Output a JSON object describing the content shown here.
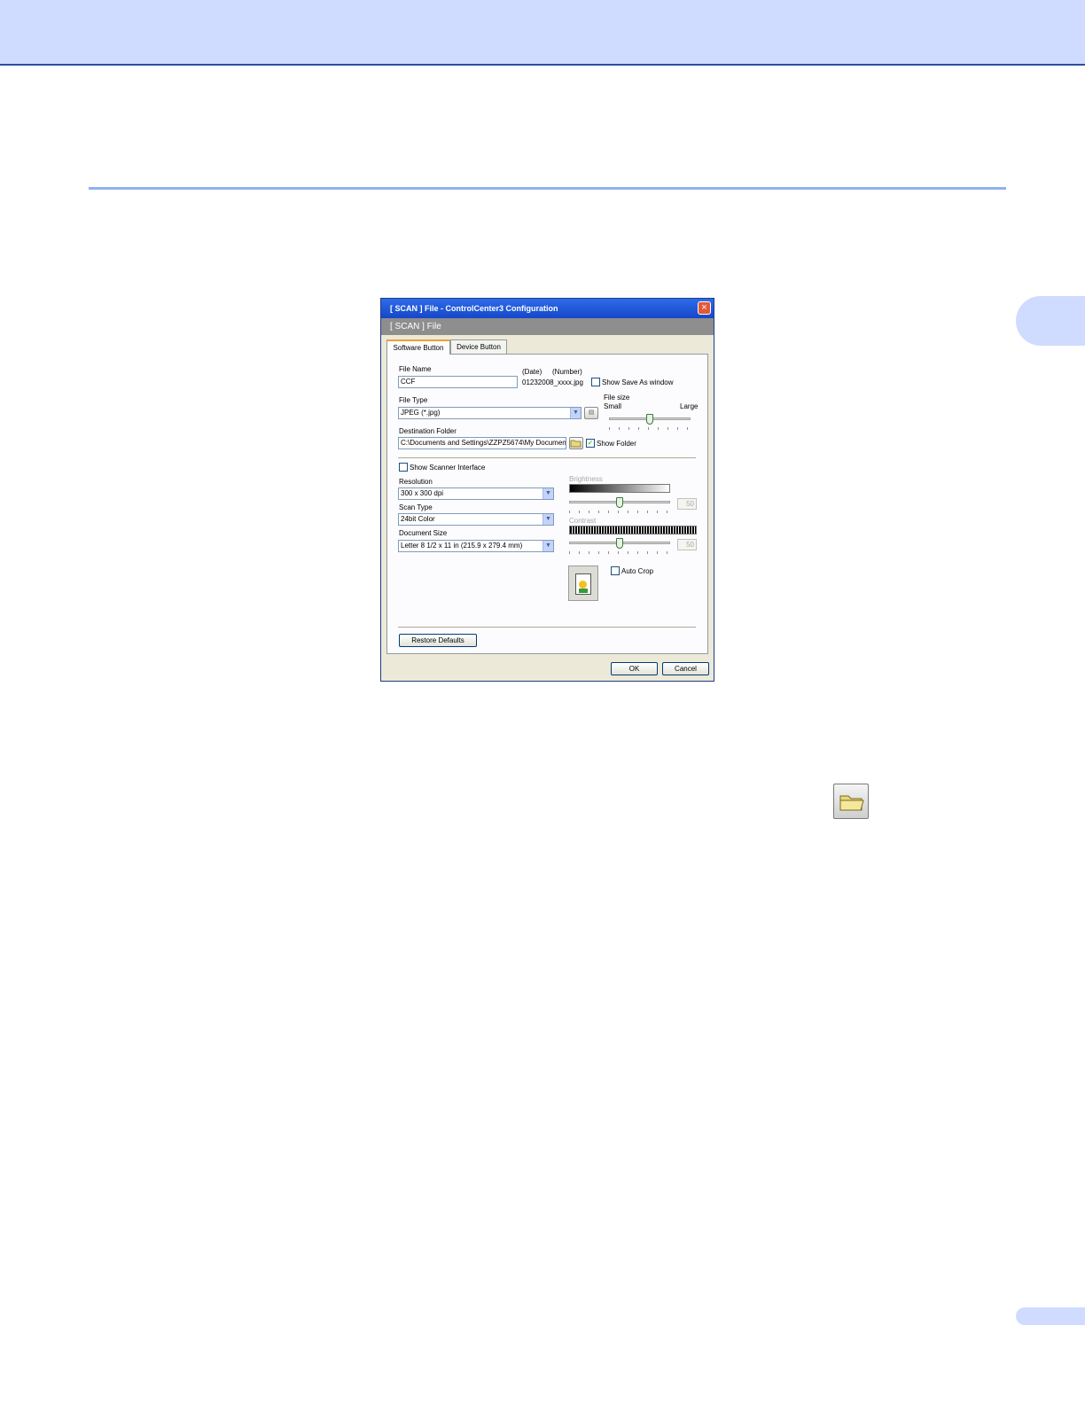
{
  "dialog": {
    "title": "[ SCAN ]   File - ControlCenter3 Configuration",
    "close_label": "×",
    "header": "[ SCAN ]   File",
    "tabs": [
      {
        "label": "Software Button"
      },
      {
        "label": "Device Button"
      }
    ],
    "file_name": {
      "label": "File Name",
      "value": "CCF",
      "date_label": "(Date)",
      "number_label": "(Number)",
      "pattern": "01232008_xxxx.jpg"
    },
    "show_save_as": {
      "label": "Show Save As window",
      "checked": false
    },
    "file_type": {
      "label": "File Type",
      "value": "JPEG (*.jpg)"
    },
    "file_size": {
      "label": "File size",
      "small": "Small",
      "large": "Large",
      "level": 0.5
    },
    "destination": {
      "label": "Destination Folder",
      "value": "C:\\Documents and Settings\\ZZPZ5674\\My Documen\\"
    },
    "show_folder": {
      "label": "Show Folder",
      "checked": true,
      "check_glyph": "✓"
    },
    "show_scanner_interface": {
      "label": "Show Scanner Interface",
      "checked": false
    },
    "resolution": {
      "label": "Resolution",
      "value": "300 x 300 dpi"
    },
    "scan_type": {
      "label": "Scan Type",
      "value": "24bit Color"
    },
    "document_size": {
      "label": "Document Size",
      "value": "Letter 8 1/2 x 11 in (215.9 x 279.4 mm)"
    },
    "brightness": {
      "label": "Brightness",
      "value": "50"
    },
    "contrast": {
      "label": "Contrast",
      "value": "50"
    },
    "auto_crop": {
      "label": "Auto Crop",
      "checked": false
    },
    "buttons": {
      "restore_defaults": "Restore Defaults",
      "ok": "OK",
      "cancel": "Cancel"
    }
  }
}
